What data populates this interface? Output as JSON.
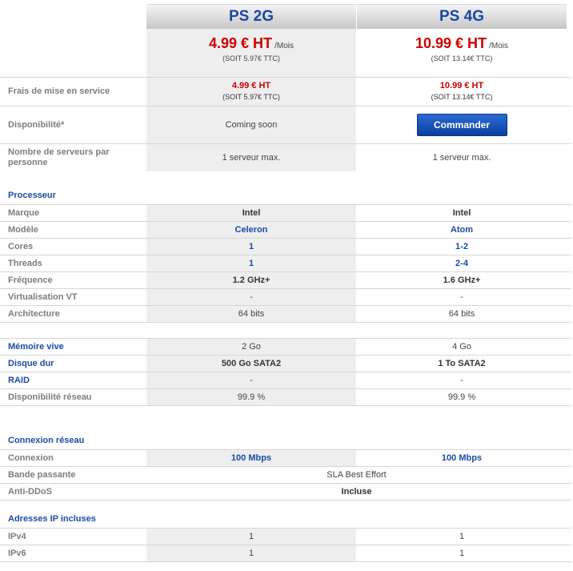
{
  "plans": [
    {
      "name": "PS 2G",
      "price": "4.99 € HT",
      "price_unit": "/Mois",
      "price_ttc": "(SOIT 5.97€ TTC)",
      "setup_fee": "4.99 € HT",
      "setup_fee_ttc": "(SOIT 5.97€ TTC)",
      "availability": "Coming soon",
      "servers": "1 serveur max."
    },
    {
      "name": "PS 4G",
      "price": "10.99 € HT",
      "price_unit": "/Mois",
      "price_ttc": "(SOIT 13.14€ TTC)",
      "setup_fee": "10.99 € HT",
      "setup_fee_ttc": "(SOIT 13.14€ TTC)",
      "order_button": "Commander",
      "servers": "1 serveur max."
    }
  ],
  "labels": {
    "setup_fee": "Frais de mise en service",
    "availability": "Disponibilité*",
    "servers": "Nombre de serveurs par personne"
  },
  "sections": {
    "processor": "Processeur",
    "network": "Connexion réseau",
    "ips": "Adresses IP incluses"
  },
  "processor_rows": [
    {
      "label": "Marque",
      "v1": "Intel",
      "v2": "Intel"
    },
    {
      "label": "Modèle",
      "v1": "Celeron",
      "v2": "Atom"
    },
    {
      "label": "Cores",
      "v1": "1",
      "v2": "1-2"
    },
    {
      "label": "Threads",
      "v1": "1",
      "v2": "2-4"
    },
    {
      "label": "Fréquence",
      "v1": "1.2 GHz+",
      "v2": "1.6 GHz+"
    },
    {
      "label": "Virtualisation VT",
      "v1": "-",
      "v2": "-"
    },
    {
      "label": "Architecture",
      "v1": "64 bits",
      "v2": "64 bits"
    }
  ],
  "hardware_rows": [
    {
      "label": "Mémoire vive",
      "v1": "2 Go",
      "v2": "4 Go"
    },
    {
      "label": "Disque dur",
      "v1": "500 Go SATA2",
      "v2": "1 To SATA2"
    },
    {
      "label": "RAID",
      "v1": "-",
      "v2": "-"
    },
    {
      "label": "Disponibilité réseau",
      "v1": "99.9 %",
      "v2": "99.9 %"
    }
  ],
  "network_rows": [
    {
      "label": "Connexion",
      "v1": "100 Mbps",
      "v2": "100 Mbps"
    },
    {
      "label": "Bande passante",
      "value": "SLA Best Effort"
    },
    {
      "label": "Anti-DDoS",
      "value": "Incluse"
    }
  ],
  "ip_rows": [
    {
      "label": "IPv4",
      "v1": "1",
      "v2": "1"
    },
    {
      "label": "IPv6",
      "v1": "1",
      "v2": "1"
    }
  ]
}
